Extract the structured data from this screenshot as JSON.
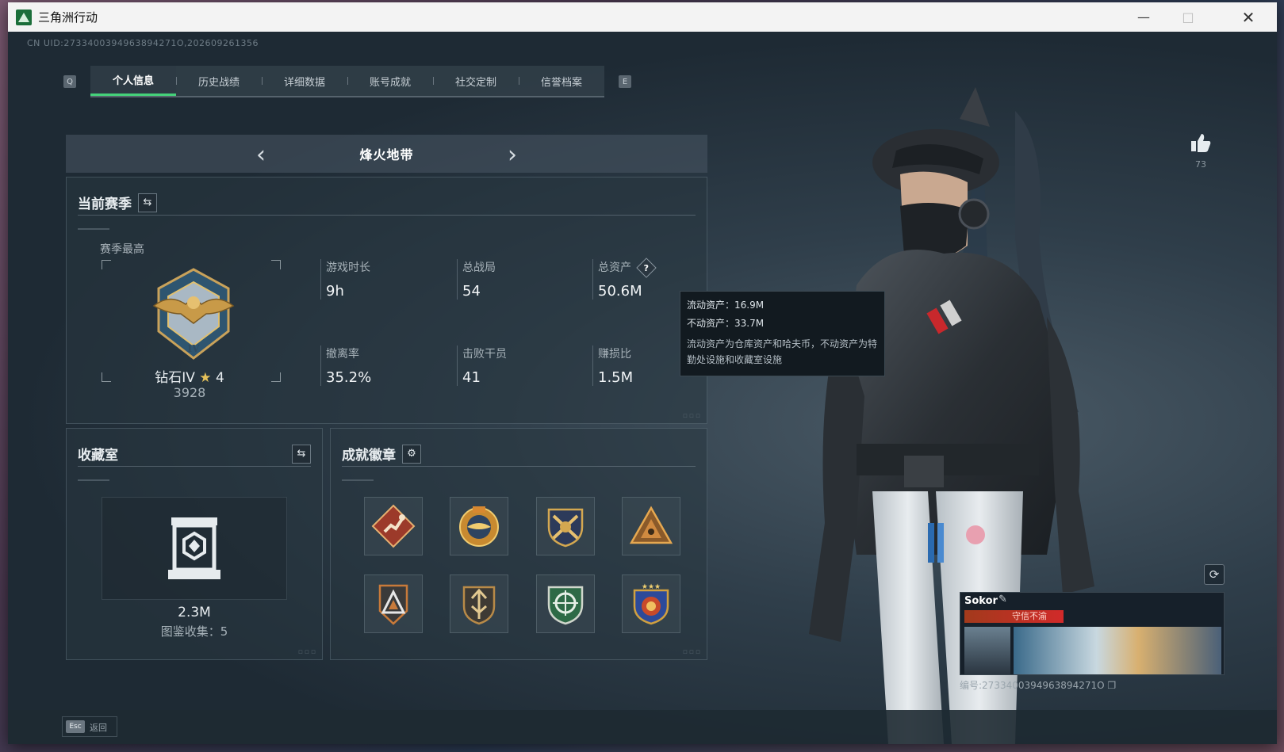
{
  "window": {
    "title": "三角洲行动"
  },
  "uid_text": "CN UID:2733400394963894271O,202609261356",
  "tabs": {
    "left_key": "Q",
    "right_key": "E",
    "items": [
      {
        "label": "个人信息",
        "active": true
      },
      {
        "label": "历史战绩",
        "active": false
      },
      {
        "label": "详细数据",
        "active": false
      },
      {
        "label": "账号成就",
        "active": false
      },
      {
        "label": "社交定制",
        "active": false
      },
      {
        "label": "信誉档案",
        "active": false
      }
    ]
  },
  "mode": {
    "title": "烽火地带"
  },
  "season": {
    "title": "当前赛季",
    "best_label": "赛季最高",
    "rank_name": "钻石IV",
    "rank_stars": "4",
    "rank_score": "3928",
    "stats": {
      "play_time": {
        "label": "游戏时长",
        "value": "9h"
      },
      "total_games": {
        "label": "总战局",
        "value": "54"
      },
      "total_assets": {
        "label": "总资产",
        "value": "50.6M"
      },
      "extract_rate": {
        "label": "撤离率",
        "value": "35.2%"
      },
      "kills": {
        "label": "击败干员",
        "value": "41"
      },
      "profit_ratio": {
        "label": "赚损比",
        "value": "1.5M"
      }
    }
  },
  "tooltip": {
    "liquid": "流动资产：16.9M",
    "fixed": "不动资产：33.7M",
    "note": "流动资产为仓库资产和哈夫币，不动资产为特勤处设施和收藏室设施"
  },
  "collection": {
    "title": "收藏室",
    "value": "2.3M",
    "count_text": "图鉴收集：5"
  },
  "badges": {
    "title": "成就徽章",
    "items": [
      {
        "icon": "runner-badge-icon",
        "color": "#b84a36"
      },
      {
        "icon": "eagle-badge-icon",
        "color": "#d49a3a"
      },
      {
        "icon": "crossed-guns-badge-icon",
        "color": "#c8a040"
      },
      {
        "icon": "triangle-badge-icon",
        "color": "#d08a40"
      },
      {
        "icon": "delta-badge-icon",
        "color": "#c87a3a"
      },
      {
        "icon": "arrow-shield-badge-icon",
        "color": "#b88a48"
      },
      {
        "icon": "green-shield-badge-icon",
        "color": "#3a8a5a"
      },
      {
        "icon": "star-shield-badge-icon",
        "color": "#3a5aa8"
      }
    ]
  },
  "profile": {
    "likes": "73",
    "name": "Sokor",
    "title_badge": "守信不渝",
    "id_text": "编号:2733400394963894271O"
  },
  "footer": {
    "esc_key": "Esc",
    "back_label": "返回"
  },
  "colors": {
    "accent": "#45d17a",
    "panel_bg": "#1f2b35"
  }
}
